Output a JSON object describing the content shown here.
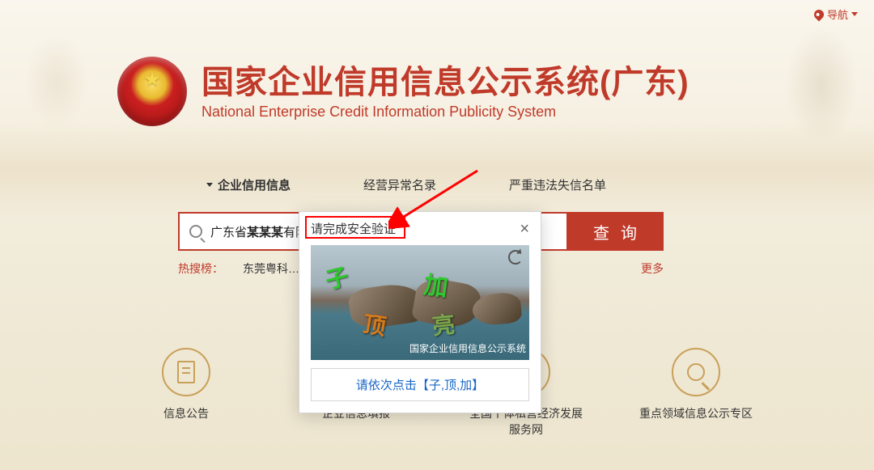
{
  "nav": {
    "label": "导航"
  },
  "header": {
    "title_cn": "国家企业信用信息公示系统(广东)",
    "title_en": "National Enterprise Credit Information Publicity System"
  },
  "tabs": [
    {
      "label": "企业信用信息",
      "active": true
    },
    {
      "label": "经营异常名录",
      "active": false
    },
    {
      "label": "严重违法失信名单",
      "active": false
    }
  ],
  "search": {
    "prefix": "广东省",
    "bold": "某某某",
    "suffix": "有限",
    "button": "查询"
  },
  "hot": {
    "label": "热搜榜：",
    "item": "东莞粤科…",
    "more": "更多"
  },
  "quicklinks": [
    {
      "label": "信息公告"
    },
    {
      "label": "企业信息填报"
    },
    {
      "label": "全国个体私营经济发展服务网"
    },
    {
      "label": "重点领域信息公示专区"
    }
  ],
  "modal": {
    "title": "请完成安全验证",
    "watermark": "国家企业信用信息公示系统",
    "instruction": "请依次点击【子,顶,加】",
    "chars": {
      "c1": "子",
      "c2": "顶",
      "c3": "加",
      "c4": "亮"
    }
  }
}
